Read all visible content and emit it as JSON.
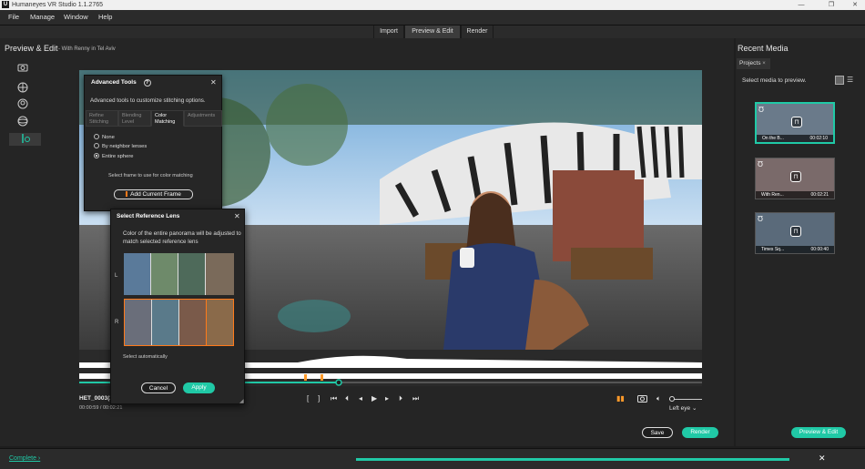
{
  "window": {
    "title": "Humaneyes VR Studio 1.1.2765",
    "app_icon": "U"
  },
  "menu": [
    "File",
    "Manage",
    "Window",
    "Help"
  ],
  "main_tabs": [
    {
      "label": "Import",
      "active": false
    },
    {
      "label": "Preview & Edit",
      "active": true
    },
    {
      "label": "Render",
      "active": false
    }
  ],
  "left": {
    "title": "Preview & Edit",
    "subtitle": "- With Renny in Tel Aviv"
  },
  "player": {
    "filename": "HET_0003(2",
    "timecode": "00:00:59 / 00:02:21",
    "eye_label": "Left eye",
    "save_label": "Save",
    "render_label": "Render"
  },
  "advanced_tools": {
    "title": "Advanced Tools",
    "description": "Advanced tools to customize stitching options.",
    "tabs": [
      {
        "label": "Refine Stitching",
        "active": false
      },
      {
        "label": "Blending Level",
        "active": false
      },
      {
        "label": "Color Matching",
        "active": true
      },
      {
        "label": "Adjustments",
        "active": false
      }
    ],
    "options": [
      {
        "label": "None",
        "selected": false
      },
      {
        "label": "By neighbor lenses",
        "selected": false
      },
      {
        "label": "Entire sphere",
        "selected": true
      }
    ],
    "frame_hint": "Select frame to use for color matching",
    "add_frame_label": "Add Current Frame"
  },
  "ref_lens": {
    "title": "Select Reference Lens",
    "body": "Color of the entire panorama will be adjusted to match selected reference lens",
    "row_labels": [
      "L",
      "R"
    ],
    "auto_label": "Select automatically",
    "cancel_label": "Cancel",
    "apply_label": "Apply"
  },
  "right": {
    "title": "Recent Media",
    "tab_label": "Projects",
    "hint": "Select media to preview.",
    "items": [
      {
        "name": "On the B...",
        "duration": "00:02:10",
        "selected": true
      },
      {
        "name": "With Ren...",
        "duration": "00:02:21",
        "selected": false
      },
      {
        "name": "Times Sq...",
        "duration": "00:00:40",
        "selected": false
      }
    ],
    "preview_edit_label": "Preview & Edit"
  },
  "status": {
    "label": "Complete",
    "progress": 1.0
  },
  "colors": {
    "accent": "#20c9a6",
    "selection_orange": "#ff7a1a"
  }
}
